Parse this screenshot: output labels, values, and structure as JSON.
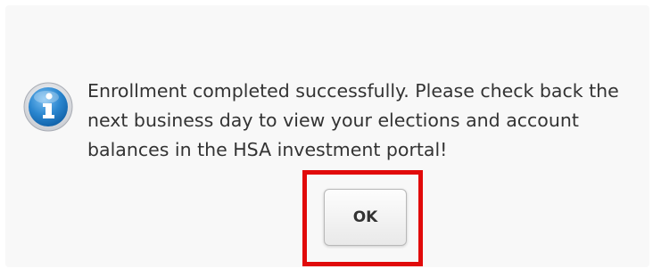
{
  "dialog": {
    "icon": "info-icon",
    "message": "Enrollment completed successfully. Please check back the next business day to view your elections and account balances in the HSA investment portal!",
    "ok_label": "OK"
  },
  "annotation": {
    "highlight_color": "#e10a0a",
    "highlight_target": "ok-button"
  },
  "colors": {
    "icon_blue": "#1f7bc3",
    "text": "#333333"
  }
}
